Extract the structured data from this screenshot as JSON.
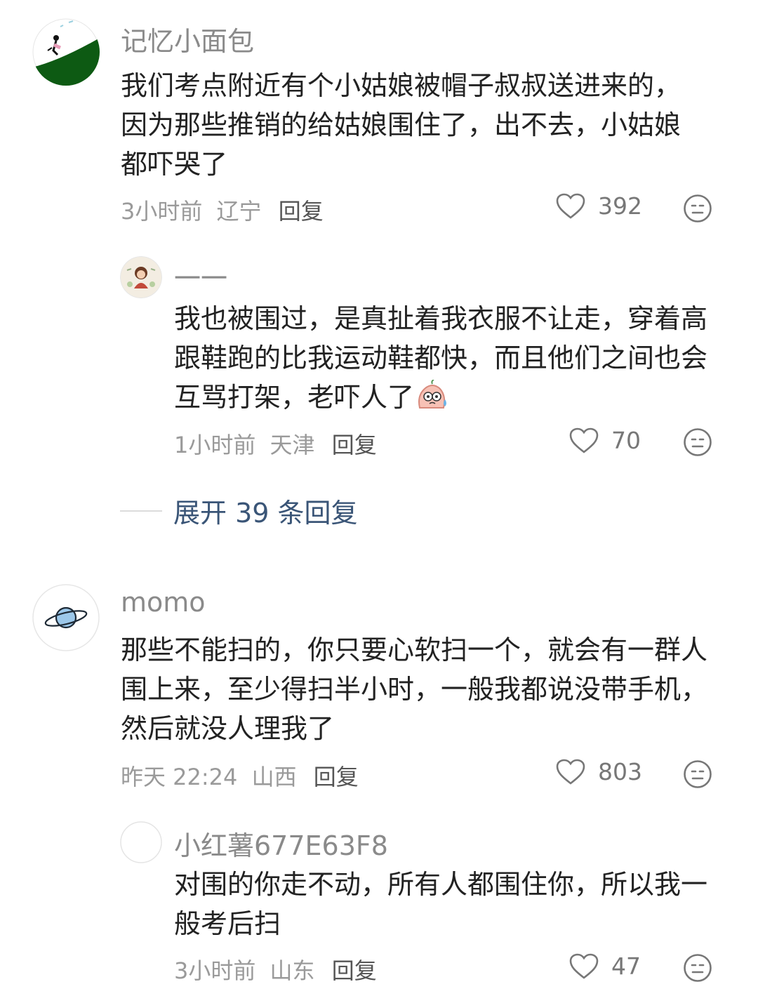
{
  "comments": [
    {
      "username": "记忆小面包",
      "text": "我们考点附近有个小姑娘被帽子叔叔送进来的，因为那些推销的给姑娘围住了，出不去，小姑娘都吓哭了",
      "time": "3小时前",
      "location": "辽宁",
      "reply_label": "回复",
      "likes": "392",
      "avatar_icon": "skiing-figure-avatar"
    },
    {
      "username": "一一",
      "text": "我也被围过，是真扯着我衣服不让走，穿着高跟鞋跑的比我运动鞋都快，而且他们之间也会互骂打架，老吓人了",
      "time": "1小时前",
      "location": "天津",
      "reply_label": "回复",
      "likes": "70",
      "avatar_icon": "illustrated-girl-avatar",
      "emoji": "sweating-face-sticker"
    },
    {
      "username": "momo",
      "text": "那些不能扫的，你只要心软扫一个，就会有一群人围上来，至少得扫半小时，一般我都说没带手机，然后就没人理我了",
      "time": "昨天 22:24",
      "location": "山西",
      "reply_label": "回复",
      "likes": "803",
      "avatar_icon": "planet-avatar"
    },
    {
      "username": "小红薯677E63F8",
      "text": "对围的你走不动，所有人都围住你，所以我一般考后扫",
      "time": "3小时前",
      "location": "山东",
      "reply_label": "回复",
      "likes": "47",
      "avatar_icon": "default-avatar"
    }
  ],
  "expand_replies": "展开 39 条回复",
  "colors": {
    "username": "#8a8a8a",
    "text": "#222222",
    "meta": "#9a9a9a",
    "expand": "#3a5577"
  }
}
